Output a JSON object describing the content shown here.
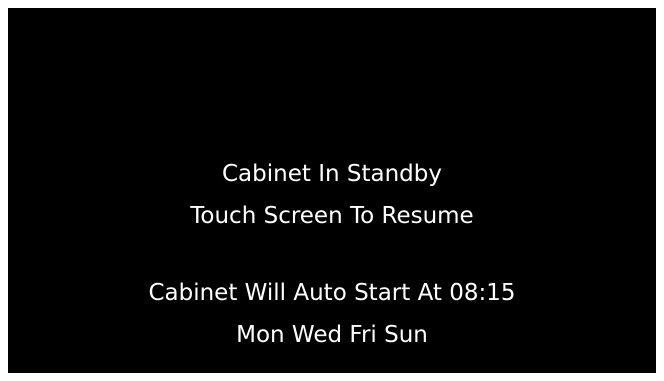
{
  "standby": {
    "status_text": "Cabinet In Standby",
    "resume_prompt": "Touch Screen To Resume",
    "auto_start_text": "Cabinet Will Auto Start At 08:15",
    "schedule_days": "Mon Wed Fri Sun"
  },
  "colors": {
    "background": "#000000",
    "text": "#ffffff",
    "border": "#ffffff"
  }
}
